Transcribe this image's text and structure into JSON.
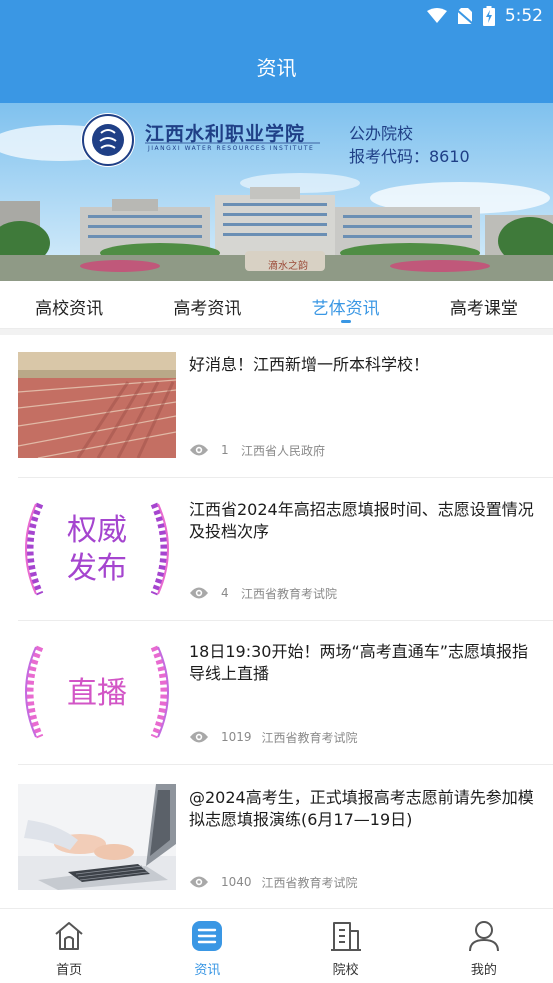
{
  "status": {
    "time": "5:52"
  },
  "header": {
    "title": "资讯"
  },
  "banner": {
    "school_name": "江西水利职业学院",
    "school_name_en": "JIANGXI  WATER  RESOURCES  INSTITUTE",
    "school_type": "公办院校",
    "code_text": "报考代码：8610",
    "stone_text": "滴水之韵"
  },
  "tabs": [
    {
      "label": "高校资讯"
    },
    {
      "label": "高考资讯"
    },
    {
      "label": "艺体资讯",
      "active": true
    },
    {
      "label": "高考课堂"
    }
  ],
  "news": [
    {
      "title": "好消息！江西新增一所本科学校！",
      "views": "1",
      "source": "江西省人民政府",
      "thumb": "track-photo"
    },
    {
      "title": "江西省2024年高招志愿填报时间、志愿设置情况及投档次序",
      "views": "4",
      "source": "江西省教育考试院",
      "thumb": "stamp",
      "thumb_text": [
        "权威",
        "发布"
      ]
    },
    {
      "title": "18日19:30开始！两场“高考直通车”志愿填报指导线上直播",
      "views": "1019",
      "source": "江西省教育考试院",
      "thumb": "stamp",
      "thumb_text": [
        "直播"
      ]
    },
    {
      "title": "@2024高考生，正式填报高考志愿前请先参加模拟志愿填报演练(6月17—19日)",
      "views": "1040",
      "source": "江西省教育考试院",
      "thumb": "laptop-photo"
    }
  ],
  "bottom_nav": [
    {
      "label": "首页",
      "icon": "home-icon"
    },
    {
      "label": "资讯",
      "icon": "news-icon",
      "active": true
    },
    {
      "label": "院校",
      "icon": "school-icon"
    },
    {
      "label": "我的",
      "icon": "user-icon"
    }
  ],
  "colors": {
    "primary": "#3a97e4",
    "stamp_purple": "#a545cf",
    "stamp_pink": "#e86bd0"
  }
}
